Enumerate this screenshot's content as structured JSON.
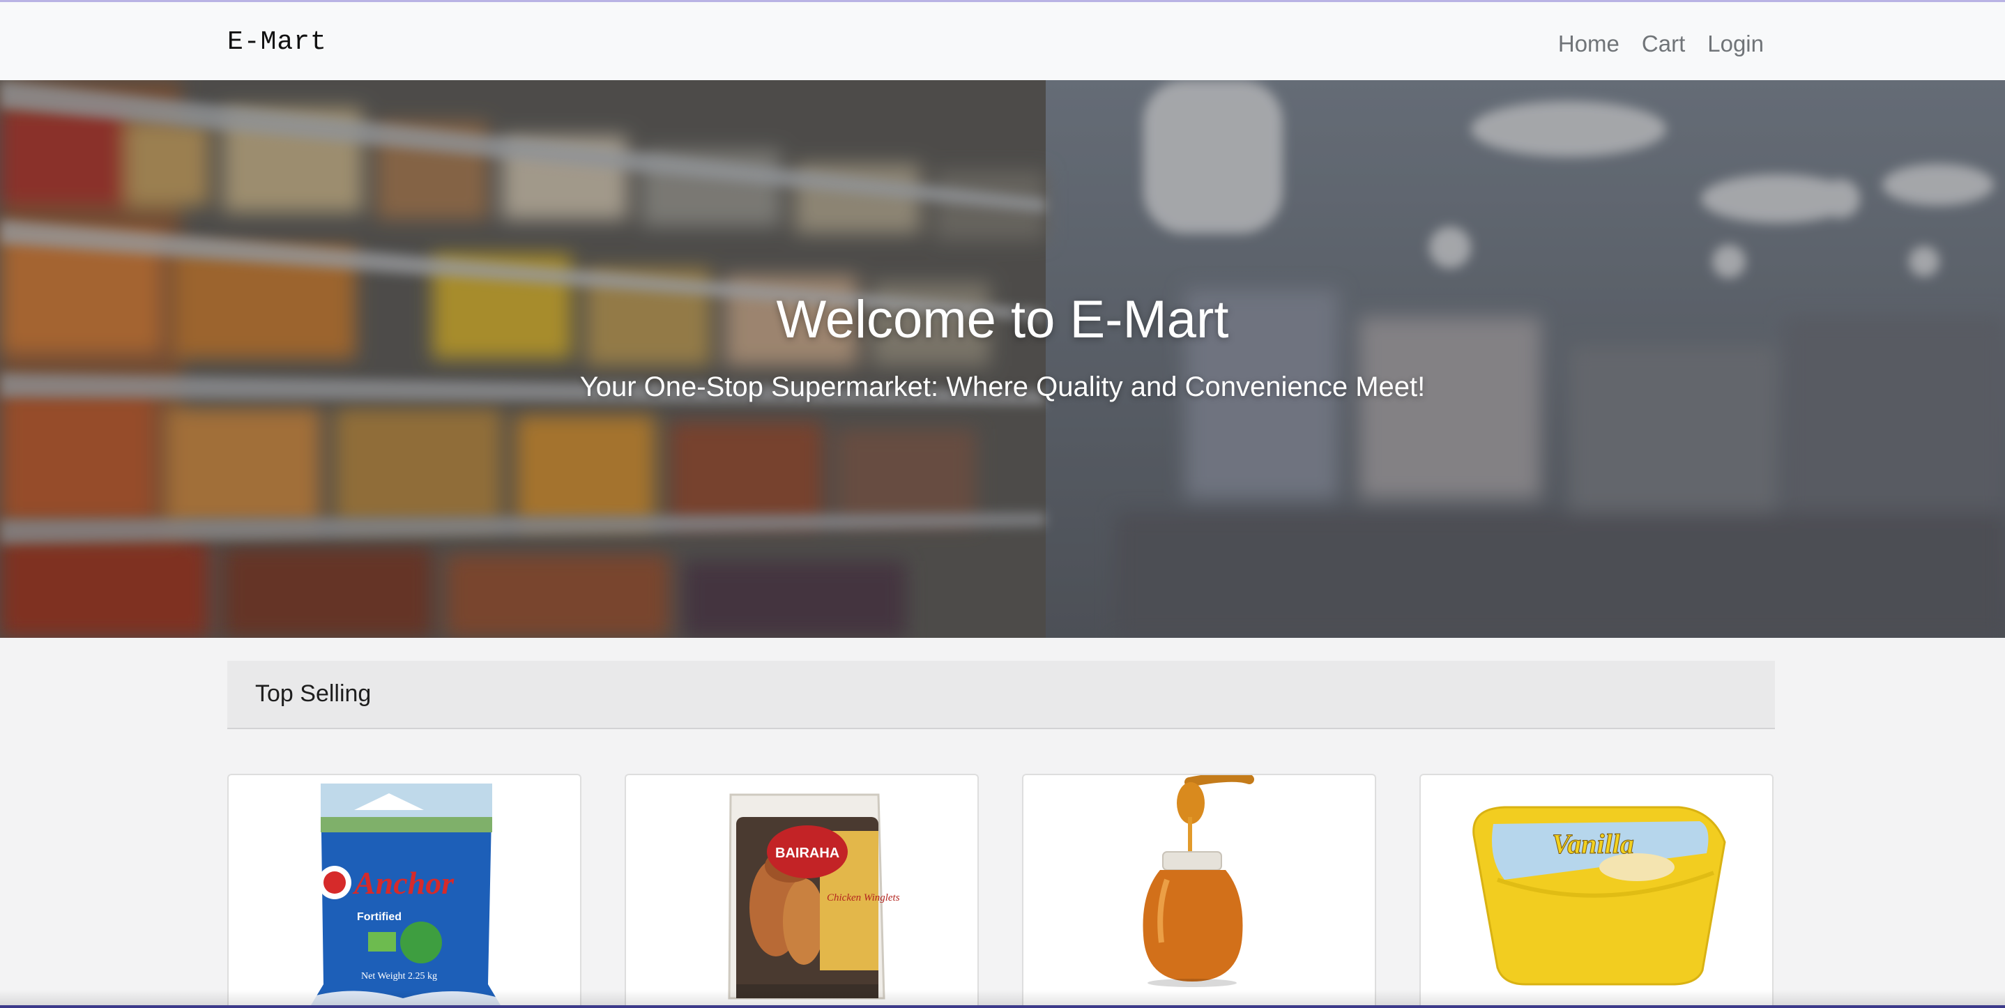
{
  "navbar": {
    "brand": "E-Mart",
    "links": [
      "Home",
      "Cart",
      "Login"
    ]
  },
  "hero": {
    "title": "Welcome to E-Mart",
    "subtitle": "Your One-Stop Supermarket: Where Quality and Convenience Meet!"
  },
  "top_selling": {
    "header": "Top Selling",
    "products": [
      {
        "image": "anchor-milk-powder-bag",
        "brand_text": "Anchor",
        "label_text": "Fortified",
        "weight_text": "Net Weight 2.25 kg"
      },
      {
        "image": "bairaha-chicken-winglets-pack",
        "brand_text": "BAIRAHA",
        "label_text": "Chicken Winglets"
      },
      {
        "image": "honey-jar-with-dipper"
      },
      {
        "image": "vanilla-ice-cream-tub",
        "label_text": "Vanilla"
      }
    ]
  }
}
